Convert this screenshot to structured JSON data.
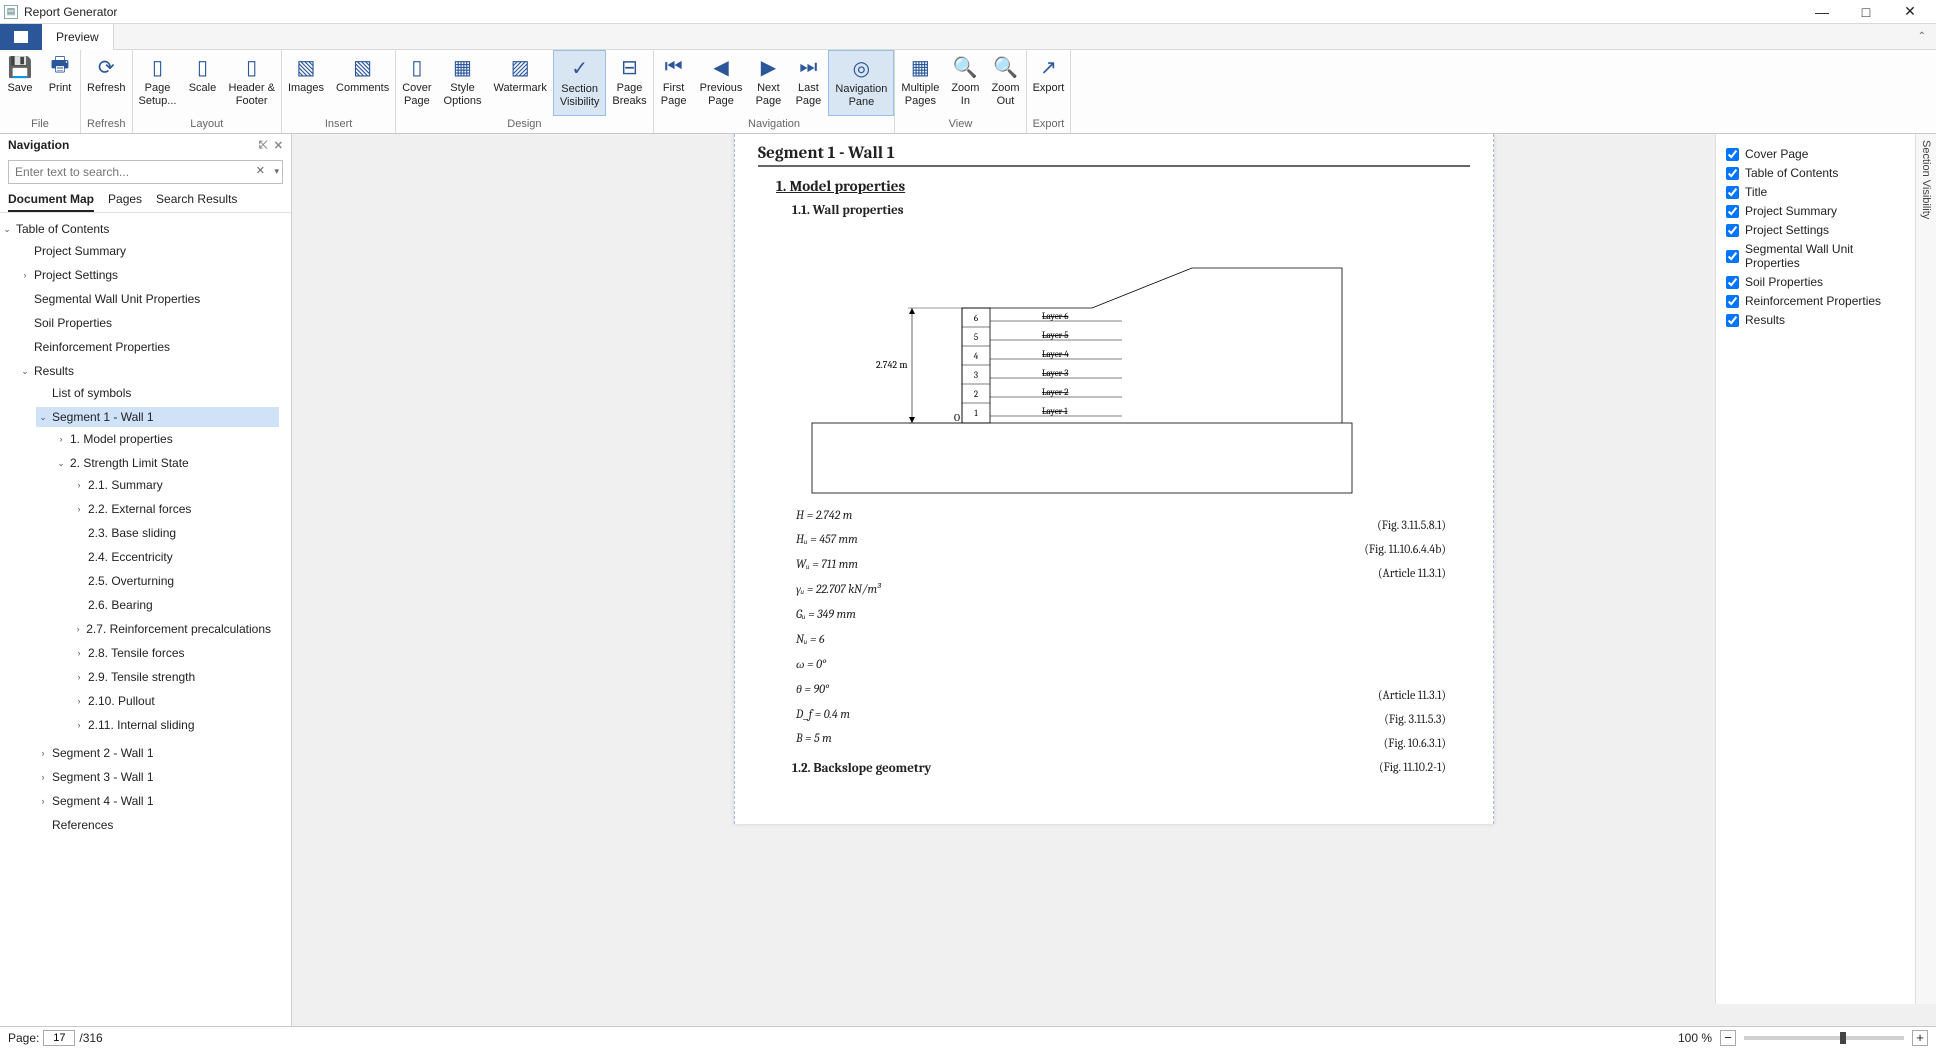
{
  "window": {
    "title": "Report Generator"
  },
  "tabs": {
    "preview": "Preview"
  },
  "ribbon": {
    "groups": {
      "file": "File",
      "refresh": "Refresh",
      "layout": "Layout",
      "insert": "Insert",
      "design": "Design",
      "navigation": "Navigation",
      "view": "View",
      "export": "Export"
    },
    "buttons": {
      "save": "Save",
      "print": "Print",
      "refresh": "Refresh",
      "page_setup": "Page\nSetup...",
      "scale": "Scale",
      "header_footer": "Header &\nFooter",
      "images": "Images",
      "comments": "Comments",
      "cover_page": "Cover\nPage",
      "style_options": "Style\nOptions",
      "watermark": "Watermark",
      "section_visibility": "Section\nVisibility",
      "page_breaks": "Page\nBreaks",
      "first_page": "First\nPage",
      "previous_page": "Previous\nPage",
      "next_page": "Next\nPage",
      "last_page": "Last\nPage",
      "navigation_pane": "Navigation\nPane",
      "multiple_pages": "Multiple\nPages",
      "zoom_in": "Zoom\nIn",
      "zoom_out": "Zoom\nOut",
      "export": "Export"
    }
  },
  "nav": {
    "title": "Navigation",
    "search_placeholder": "Enter text to search...",
    "tabs": {
      "docmap": "Document Map",
      "pages": "Pages",
      "results": "Search Results"
    },
    "tree": {
      "root": "Table of Contents",
      "items": {
        "project_summary": "Project Summary",
        "project_settings": "Project Settings",
        "seg_wall_props": "Segmental Wall Unit Properties",
        "soil_props": "Soil Properties",
        "reinf_props": "Reinforcement Properties",
        "results": "Results",
        "list_symbols": "List of symbols",
        "seg1": "Segment 1 - Wall 1",
        "mp": "1.  Model properties",
        "sls": "2.  Strength Limit State",
        "s21": "2.1.  Summary",
        "s22": "2.2.  External forces",
        "s23": "2.3.  Base sliding",
        "s24": "2.4.  Eccentricity",
        "s25": "2.5.  Overturning",
        "s26": "2.6.  Bearing",
        "s27": "2.7.  Reinforcement precalculations",
        "s28": "2.8.  Tensile forces",
        "s29": "2.9.  Tensile strength",
        "s210": "2.10.  Pullout",
        "s211": "2.11.  Internal sliding",
        "seg2": "Segment 2 - Wall 1",
        "seg3": "Segment 3 - Wall 1",
        "seg4": "Segment 4 - Wall 1",
        "references": "References"
      }
    }
  },
  "doc": {
    "segment_title": "Segment 1 - Wall 1",
    "h1_model": "1.  Model properties",
    "h11": "1.1.  Wall properties",
    "h12": "1.2.  Backslope geometry",
    "diagram": {
      "height_label": "2.742 m",
      "origin": "O",
      "layers": [
        "Layer 6",
        "Layer 5",
        "Layer 4",
        "Layer 3",
        "Layer 2",
        "Layer 1"
      ],
      "block_numbers": [
        "6",
        "5",
        "4",
        "3",
        "2",
        "1"
      ]
    },
    "props": {
      "p1": "H = 2.742 m",
      "p2": "Hᵤ = 457 mm",
      "p3": "Wᵤ = 711 mm",
      "p4": "γᵤ = 22.707 kN/m³",
      "p5": "Gᵤ = 349 mm",
      "p6": "Nᵤ = 6",
      "p7": "ω = 0°",
      "p8": "θ = 90°",
      "p9": "D_f = 0.4 m",
      "p10": "B = 5 m"
    },
    "refs": {
      "r1": "(Fig. 3.11.5.8.1)",
      "r2": "(Fig. 11.10.6.4.4b)",
      "r3": "(Article 11.3.1)",
      "r4": "(Article 11.3.1)",
      "r5": "(Fig. 3.11.5.3)",
      "r6": "(Fig. 10.6.3.1)",
      "r7": "(Fig. 11.10.2-1)"
    }
  },
  "visibility": {
    "label": "Section Visibility",
    "items": {
      "cover": "Cover Page",
      "toc": "Table of Contents",
      "title": "Title",
      "psum": "Project Summary",
      "pset": "Project Settings",
      "swu": "Segmental Wall Unit Properties",
      "soil": "Soil Properties",
      "reinf": "Reinforcement Properties",
      "results": "Results"
    }
  },
  "status": {
    "page_label": "Page:",
    "current_page": "17",
    "total_pages": "316",
    "zoom": "100 %"
  }
}
